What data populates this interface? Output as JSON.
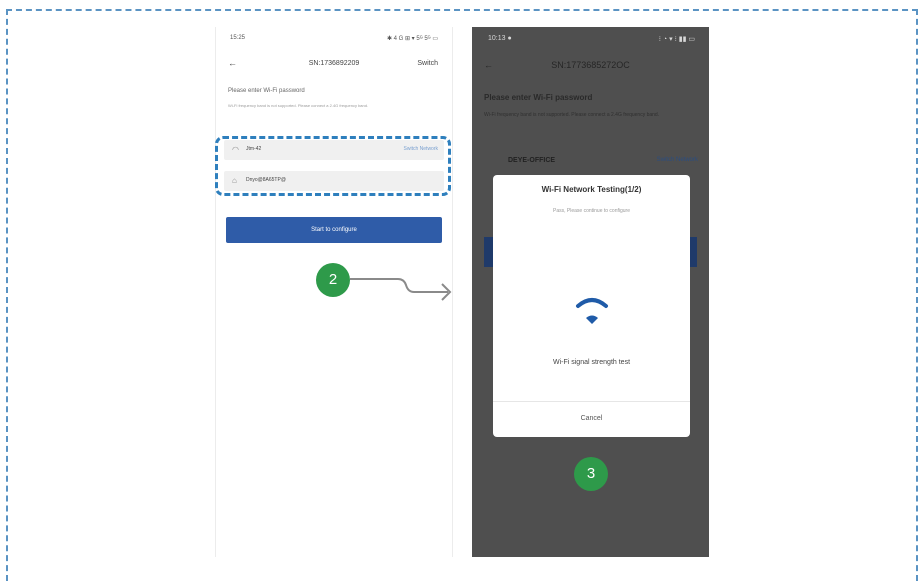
{
  "left_screen": {
    "status_time": "15:25",
    "status_icons": "✱ 4 G ⊞ ▾ 5ᴳ 5ᴳ ▭",
    "back_icon": "arrow-left-icon",
    "title": "SN:1736892209",
    "switch_label": "Switch",
    "prompt": "Please enter Wi-Fi password",
    "hint": "Wi-Fi frequency band is not supported. Please connect a 2.4G frequency band.",
    "network_name": "Jtm-42",
    "switch_network_label": "Switch Network",
    "password_value": "Dnyo@8A65TP@",
    "start_button": "Start to configure"
  },
  "right_screen": {
    "status_time": "10:13 ●",
    "status_icons": "⁝ ◔ ▾ ⁝ ▮▮ ▭",
    "back_icon": "arrow-left-icon",
    "title": "SN:1773685272OC",
    "prompt": "Please enter Wi-Fi password",
    "hint": "Wi-Fi frequency band is not supported. Please connect a 2.4G frequency band.",
    "network_name": "DEYE-OFFICE",
    "switch_network_label": "Switch Network"
  },
  "modal": {
    "title": "Wi-Fi Network Testing(1/2)",
    "subtitle": "Pass, Please continue to configure",
    "icon": "wifi-icon",
    "status": "Wi-Fi signal strength test",
    "cancel": "Cancel"
  },
  "steps": {
    "step2": "2",
    "step3": "3"
  },
  "colors": {
    "accent_blue": "#2f5ca8",
    "step_green": "#2e9a4a",
    "highlight_dash": "#2e7fbd",
    "wifi_blue": "#1f5ba8"
  }
}
